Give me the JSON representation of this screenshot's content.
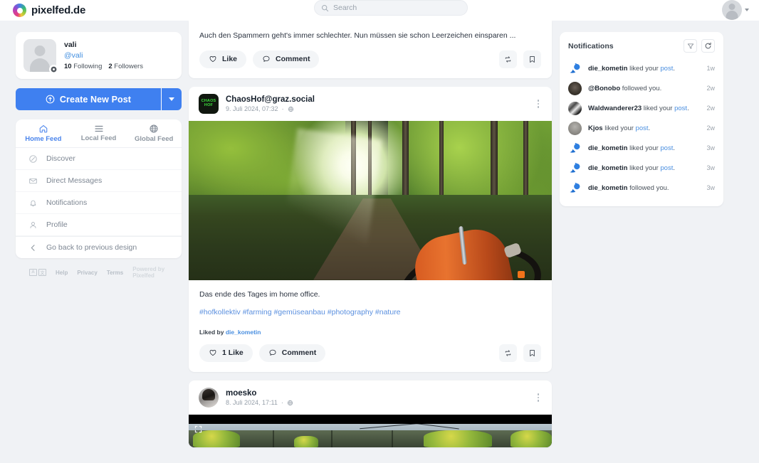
{
  "brand": {
    "name": "pixelfed.de",
    "logo_icon": "pixelfed-logo-icon"
  },
  "search": {
    "placeholder": "Search",
    "icon": "search-icon"
  },
  "topbar": {
    "avatar_icon": "user-avatar-icon",
    "caret_icon": "chevron-down-icon"
  },
  "profile": {
    "display_name": "vali",
    "handle": "@vali",
    "following_count": "10",
    "following_label": "Following",
    "followers_count": "2",
    "followers_label": "Followers",
    "settings_icon": "gear-icon",
    "avatar_icon": "user-avatar-icon"
  },
  "compose": {
    "label": "Create New Post",
    "icon": "upload-circle-icon",
    "dropdown_icon": "chevron-down-icon",
    "accent": "#3f80f0"
  },
  "feed_tabs": [
    {
      "label": "Home Feed",
      "icon": "home-icon",
      "active": true
    },
    {
      "label": "Local Feed",
      "icon": "list-lines-icon",
      "active": false
    },
    {
      "label": "Global Feed",
      "icon": "globe-icon",
      "active": false
    }
  ],
  "nav_items": [
    {
      "label": "Discover",
      "icon": "compass-icon"
    },
    {
      "label": "Direct Messages",
      "icon": "envelope-icon"
    },
    {
      "label": "Notifications",
      "icon": "bell-icon"
    },
    {
      "label": "Profile",
      "icon": "person-icon"
    },
    {
      "label": "Go back to previous design",
      "icon": "chevron-left-icon"
    }
  ],
  "footer": {
    "lang_left": "A",
    "lang_right": "文",
    "links": [
      "Help",
      "Privacy",
      "Terms"
    ],
    "powered_by": "Powered by Pixelfed"
  },
  "posts": [
    {
      "id": "post-partial-top",
      "text": "Auch den Spammern geht's immer schlechter. Nun müssen sie schon Leerzeichen einsparen ...",
      "like_label": "Like",
      "comment_label": "Comment",
      "repost_icon": "repost-icon",
      "bookmark_icon": "bookmark-icon"
    },
    {
      "id": "post-chaoshof",
      "author": "ChaosHof@graz.social",
      "avatar_line1": "CHAOS",
      "avatar_line2": "HOF",
      "timestamp": "9. Juli 2024, 07:32",
      "visibility_icon": "globe-icon",
      "menu_icon": "kebab-menu-icon",
      "caption": "Das ende des Tages im home office.",
      "hashtags": "#hofkollektiv #farming #gemüseanbau #photography #nature",
      "liked_by_prefix": "Liked by",
      "liked_by_user": "die_kometin",
      "like_label": "1 Like",
      "comment_label": "Comment",
      "repost_icon": "repost-icon",
      "bookmark_icon": "bookmark-icon"
    },
    {
      "id": "post-moesko",
      "author": "moesko",
      "timestamp": "8. Juli 2024, 17:11",
      "visibility_icon": "globe-icon",
      "menu_icon": "kebab-menu-icon",
      "expand_icon": "fullscreen-expand-icon"
    }
  ],
  "notifications": {
    "title": "Notifications",
    "filter_icon": "filter-funnel-icon",
    "refresh_icon": "refresh-icon",
    "items": [
      {
        "user": "die_kometin",
        "action": " liked your ",
        "link": "post",
        "suffix": ".",
        "time": "1w",
        "avatar": "comet-icon"
      },
      {
        "user": "@Bonobo",
        "action": " followed you.",
        "link": "",
        "suffix": "",
        "time": "2w",
        "avatar": "monkey-photo-icon"
      },
      {
        "user": "Waldwanderer23",
        "action": " liked your ",
        "link": "post",
        "suffix": ".",
        "time": "2w",
        "avatar": "bw-photo-icon"
      },
      {
        "user": "Kjos",
        "action": " liked your ",
        "link": "post",
        "suffix": ".",
        "time": "2w",
        "avatar": "gray-photo-icon"
      },
      {
        "user": "die_kometin",
        "action": " liked your ",
        "link": "post",
        "suffix": ".",
        "time": "3w",
        "avatar": "comet-icon"
      },
      {
        "user": "die_kometin",
        "action": " liked your ",
        "link": "post",
        "suffix": ".",
        "time": "3w",
        "avatar": "comet-icon"
      },
      {
        "user": "die_kometin",
        "action": " followed you.",
        "link": "",
        "suffix": "",
        "time": "3w",
        "avatar": "comet-icon"
      }
    ]
  }
}
